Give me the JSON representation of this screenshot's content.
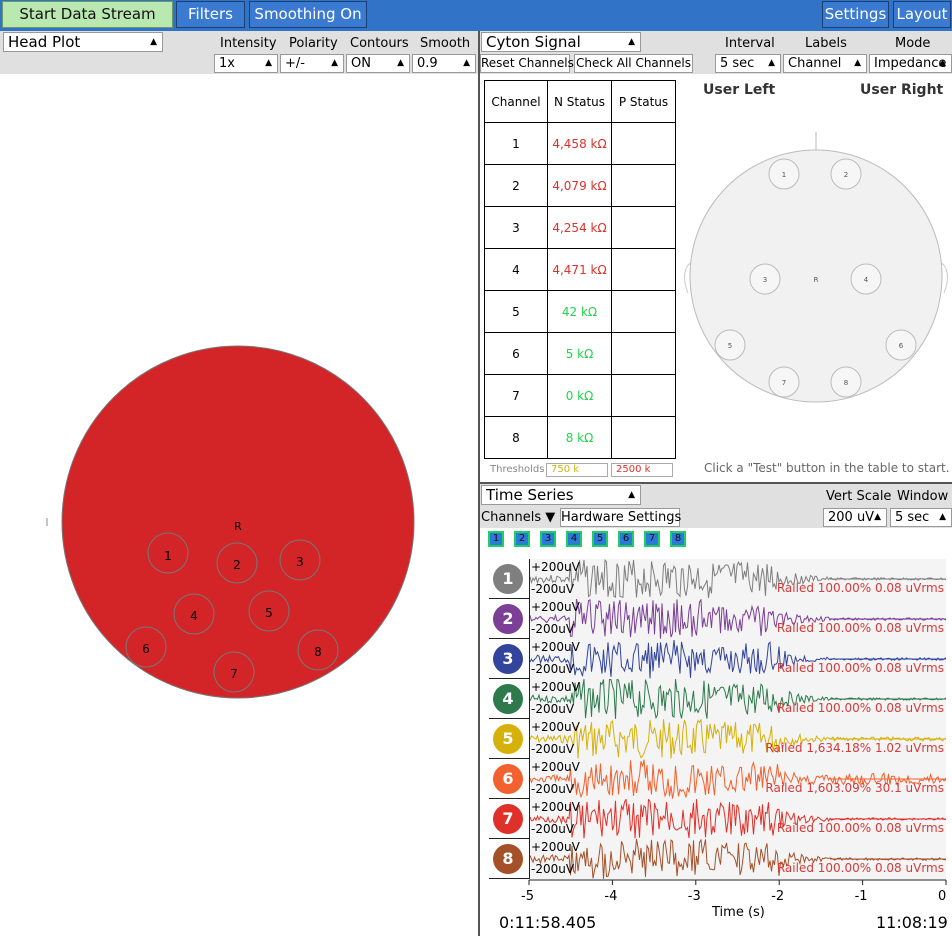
{
  "toolbar": {
    "start": "Start Data Stream",
    "filters": "Filters",
    "smoothing": "Smoothing On",
    "settings": "Settings",
    "layout": "Layout"
  },
  "headplot": {
    "title": "Head Plot",
    "intensity_label": "Intensity",
    "intensity_value": "1x",
    "polarity_label": "Polarity",
    "polarity_value": "+/-",
    "contours_label": "Contours",
    "contours_value": "ON",
    "smooth_label": "Smooth",
    "smooth_value": "0.9",
    "ref_label": "R",
    "electrodes": [
      "1",
      "2",
      "3",
      "4",
      "5",
      "6",
      "7",
      "8"
    ],
    "fill_color": "#d32527"
  },
  "cyton": {
    "title": "Cyton Signal",
    "reset": "Reset Channels",
    "check_all": "Check All Channels",
    "interval_label": "Interval",
    "interval_value": "5 sec",
    "labels_label": "Labels",
    "labels_value": "Channel",
    "mode_label": "Mode",
    "mode_value": "Impedance",
    "table_headers": [
      "Channel",
      "N Status",
      "P Status"
    ],
    "rows": [
      {
        "ch": "1",
        "n": "4,458 kΩ",
        "p": "",
        "color": "#e0302a"
      },
      {
        "ch": "2",
        "n": "4,079 kΩ",
        "p": "",
        "color": "#e0302a"
      },
      {
        "ch": "3",
        "n": "4,254 kΩ",
        "p": "",
        "color": "#e0302a"
      },
      {
        "ch": "4",
        "n": "4,471 kΩ",
        "p": "",
        "color": "#e0302a"
      },
      {
        "ch": "5",
        "n": "42 kΩ",
        "p": "",
        "color": "#23d34c"
      },
      {
        "ch": "6",
        "n": "5 kΩ",
        "p": "",
        "color": "#23d34c"
      },
      {
        "ch": "7",
        "n": "0 kΩ",
        "p": "",
        "color": "#23d34c"
      },
      {
        "ch": "8",
        "n": "8 kΩ",
        "p": "",
        "color": "#23d34c"
      }
    ],
    "thresholds_label": "Thresholds",
    "threshold_low": "750 k",
    "threshold_high": "2500 k",
    "user_left": "User Left",
    "user_right": "User Right",
    "head_ref": "R",
    "hint": "Click a \"Test\" button in the table to start."
  },
  "timeseries": {
    "title": "Time Series",
    "vert_scale_label": "Vert Scale",
    "vert_scale_value": "200 uV",
    "window_label": "Window",
    "window_value": "5 sec",
    "channels_label": "Channels",
    "hardware_settings": "Hardware Settings",
    "channel_toggles": [
      "1",
      "2",
      "3",
      "4",
      "5",
      "6",
      "7",
      "8"
    ],
    "plus_label": "+200uV",
    "minus_label": "-200uV",
    "channels": [
      {
        "n": "1",
        "color": "#7f7f7f",
        "status": "Railed 100.00% 0.08 uVrms"
      },
      {
        "n": "2",
        "color": "#7b3f96",
        "status": "Railed 100.00% 0.08 uVrms"
      },
      {
        "n": "3",
        "color": "#32449b",
        "status": "Railed 100.00% 0.08 uVrms"
      },
      {
        "n": "4",
        "color": "#2f7a4d",
        "status": "Railed 100.00% 0.08 uVrms"
      },
      {
        "n": "5",
        "color": "#d6b10a",
        "status": "Railed 1,634.18% 1.02 uVrms"
      },
      {
        "n": "6",
        "color": "#f2612e",
        "status": "Railed 1,603.09% 30.1 uVrms"
      },
      {
        "n": "7",
        "color": "#e0302a",
        "status": "Railed 100.00% 0.08 uVrms"
      },
      {
        "n": "8",
        "color": "#a4512a",
        "status": "Railed 100.00% 0.08 uVrms"
      }
    ],
    "x_ticks": [
      "-5",
      "-4",
      "-3",
      "-2",
      "-1",
      "0"
    ],
    "x_label": "Time (s)",
    "elapsed": "0:11:58.405",
    "clock": "11:08:19"
  }
}
